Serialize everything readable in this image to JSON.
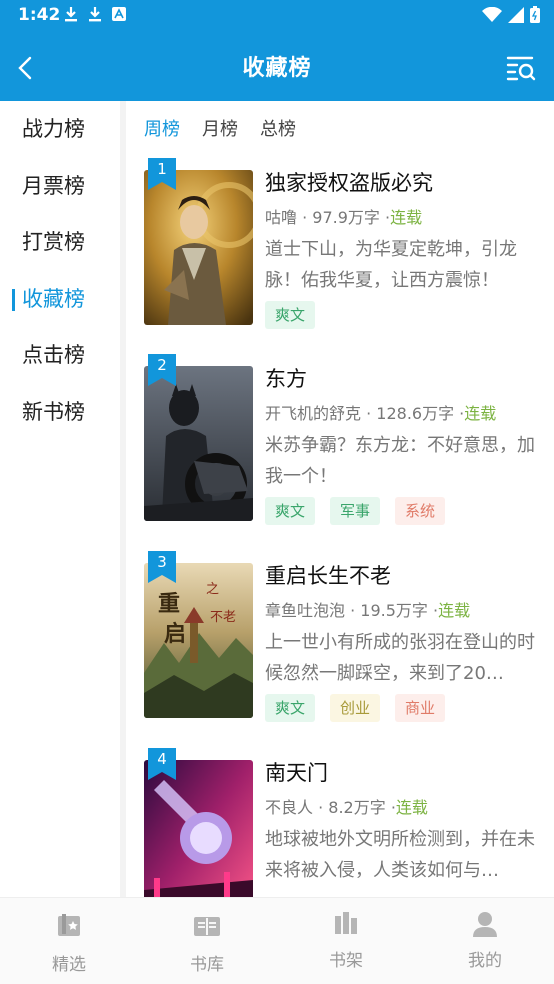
{
  "status_bar": {
    "time": "1:42"
  },
  "header": {
    "title": "收藏榜"
  },
  "sidebar": {
    "items": [
      {
        "label": "战力榜",
        "active": false
      },
      {
        "label": "月票榜",
        "active": false
      },
      {
        "label": "打赏榜",
        "active": false
      },
      {
        "label": "收藏榜",
        "active": true
      },
      {
        "label": "点击榜",
        "active": false
      },
      {
        "label": "新书榜",
        "active": false
      }
    ]
  },
  "tabs": [
    {
      "label": "周榜",
      "active": true
    },
    {
      "label": "月榜",
      "active": false
    },
    {
      "label": "总榜",
      "active": false
    }
  ],
  "books": [
    {
      "rank": "1",
      "title": "独家授权盗版必究",
      "author": "咕噜",
      "words": "97.9万字",
      "status": "连载",
      "desc": "道士下山，为华夏定乾坤，引龙脉！佑我华夏，让西方震惊！",
      "tags": [
        {
          "label": "爽文",
          "color": "green"
        }
      ]
    },
    {
      "rank": "2",
      "title": "东方",
      "author": "开飞机的舒克",
      "words": "128.6万字",
      "status": "连载",
      "desc": "米苏争霸？东方龙：不好意思，加我一个！",
      "tags": [
        {
          "label": "爽文",
          "color": "green"
        },
        {
          "label": "军事",
          "color": "green"
        },
        {
          "label": "系统",
          "color": "pink"
        }
      ]
    },
    {
      "rank": "3",
      "title": "重启长生不老",
      "author": "章鱼吐泡泡",
      "words": "19.5万字",
      "status": "连载",
      "desc": "上一世小有所成的张羽在登山的时候忽然一脚踩空，来到了20…",
      "tags": [
        {
          "label": "爽文",
          "color": "green"
        },
        {
          "label": "创业",
          "color": "yellow"
        },
        {
          "label": "商业",
          "color": "pink"
        }
      ]
    },
    {
      "rank": "4",
      "title": "南天门",
      "author": "不良人",
      "words": "8.2万字",
      "status": "连载",
      "desc": "地球被地外文明所检测到，并在未来将被入侵，人类该如何与…",
      "tags": []
    }
  ],
  "bottom_nav": [
    {
      "label": "精选",
      "icon": "featured-icon"
    },
    {
      "label": "书库",
      "icon": "library-icon"
    },
    {
      "label": "书架",
      "icon": "bookshelf-icon"
    },
    {
      "label": "我的",
      "icon": "profile-icon"
    }
  ],
  "colors": {
    "primary": "#1296db",
    "status_tag": "#7cb342"
  }
}
